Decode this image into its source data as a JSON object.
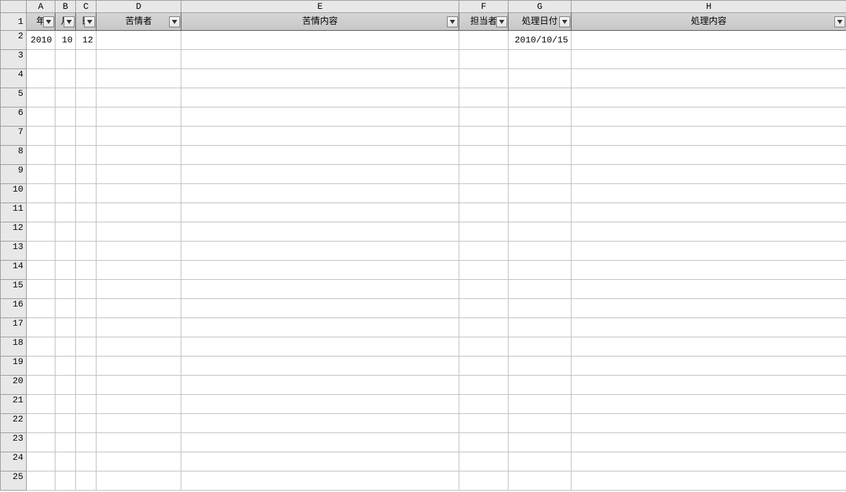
{
  "columns": [
    "A",
    "B",
    "C",
    "D",
    "E",
    "F",
    "G",
    "H"
  ],
  "rowCount": 25,
  "headers": {
    "A": "年",
    "B": "月",
    "C": "日",
    "D": "苦情者",
    "E": "苦情内容",
    "F": "担当者",
    "G": "処理日付",
    "H": "処理内容"
  },
  "rows": {
    "2": {
      "A": "2010",
      "B": "10",
      "C": "12",
      "D": "",
      "E": "",
      "F": "",
      "G": "2010/10/15",
      "H": ""
    }
  }
}
